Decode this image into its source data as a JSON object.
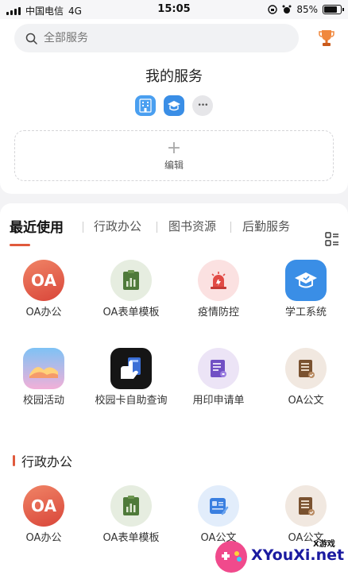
{
  "status_bar": {
    "carrier": "中国电信",
    "network": "4G",
    "time": "15:05",
    "battery": "85%",
    "battery_level": 0.85
  },
  "search": {
    "placeholder": "全部服务"
  },
  "my_services": {
    "title": "我的服务",
    "edit_label": "编辑",
    "edit_icon": "+",
    "more_icon": "•••"
  },
  "tabs": [
    {
      "label": "最近使用"
    },
    {
      "label": "行政办公"
    },
    {
      "label": "图书资源"
    },
    {
      "label": "后勤服务"
    }
  ],
  "recent_apps": [
    {
      "label": "OA办公",
      "icon": "OA"
    },
    {
      "label": "OA表单模板",
      "icon": "form-chart-icon"
    },
    {
      "label": "疫情防控",
      "icon": "alarm-icon"
    },
    {
      "label": "学工系统",
      "icon": "graduation-cap-icon"
    },
    {
      "label": "校园活动",
      "icon": "landscape-icon"
    },
    {
      "label": "校园卡自助查询",
      "icon": "card-hand-icon"
    },
    {
      "label": "用印申请单",
      "icon": "stamp-form-icon"
    },
    {
      "label": "OA公文",
      "icon": "document-icon"
    }
  ],
  "section": {
    "title": "行政办公"
  },
  "admin_apps": [
    {
      "label": "OA办公",
      "icon": "OA"
    },
    {
      "label": "OA表单模板",
      "icon": "form-chart-icon"
    },
    {
      "label": "OA公文",
      "icon": "id-card-icon"
    },
    {
      "label": "OA公文",
      "icon": "document-icon"
    }
  ],
  "watermark": {
    "text": "XYouXi.net",
    "small": "X游戏"
  },
  "colors": {
    "accent": "#e05a3c",
    "blue": "#3a8ee6"
  }
}
